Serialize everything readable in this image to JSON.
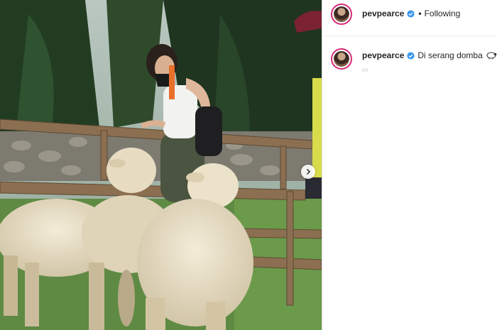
{
  "post": {
    "username": "pevpearce",
    "follow_status": "Following",
    "caption": "Di serang domba",
    "timestamp": "6h"
  },
  "icons": {
    "verified": "verified-badge-icon",
    "sheep_emoji": "sheep-emoji-icon",
    "next": "chevron-right-icon"
  },
  "colors": {
    "verified_blue": "#3897f0",
    "avatar_ring": "#d62976"
  }
}
